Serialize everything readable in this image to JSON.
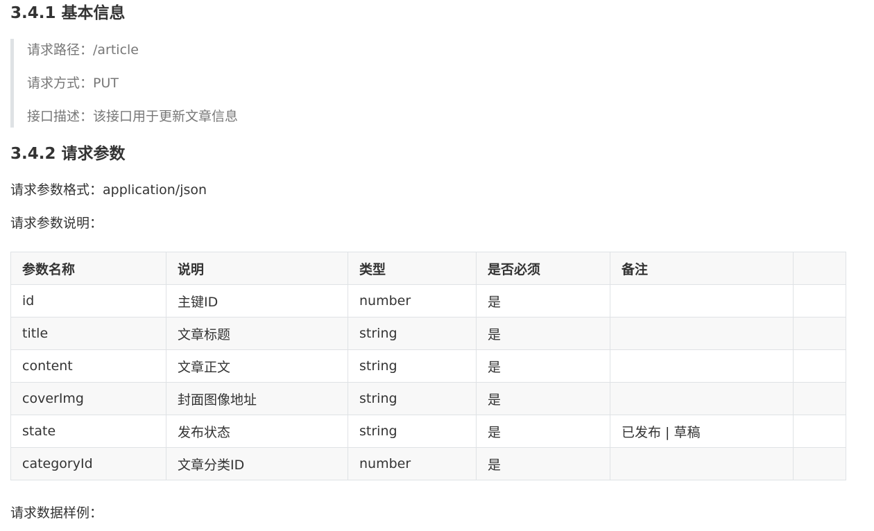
{
  "section_basic": {
    "heading": "3.4.1 基本信息",
    "path_line": "请求路径：/article",
    "method_line": "请求方式：PUT",
    "desc_line": "接口描述：该接口用于更新文章信息"
  },
  "section_params": {
    "heading": "3.4.2 请求参数",
    "format_line": "请求参数格式：application/json",
    "explain_line": "请求参数说明：",
    "table": {
      "headers": [
        "参数名称",
        "说明",
        "类型",
        "是否必须",
        "备注",
        ""
      ],
      "rows": [
        [
          "id",
          "主键ID",
          "number",
          "是",
          "",
          ""
        ],
        [
          "title",
          "文章标题",
          "string",
          "是",
          "",
          ""
        ],
        [
          "content",
          "文章正文",
          "string",
          "是",
          "",
          ""
        ],
        [
          "coverImg",
          "封面图像地址",
          "string",
          "是",
          "",
          ""
        ],
        [
          "state",
          "发布状态",
          "string",
          "是",
          "已发布 | 草稿",
          ""
        ],
        [
          "categoryId",
          "文章分类ID",
          "number",
          "是",
          "",
          ""
        ]
      ]
    },
    "sample_line": "请求数据样例："
  }
}
